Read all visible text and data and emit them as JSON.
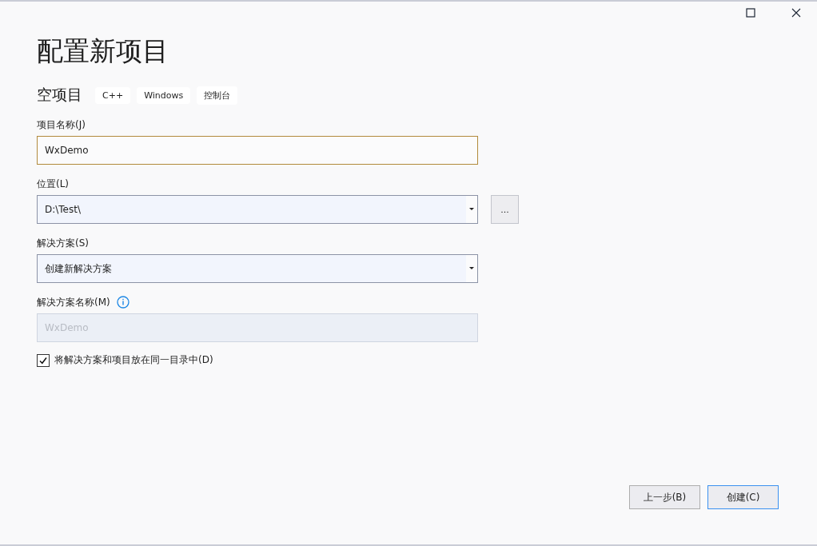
{
  "window": {
    "title": "配置新项目"
  },
  "template": {
    "name": "空项目",
    "tags": [
      "C++",
      "Windows",
      "控制台"
    ]
  },
  "fields": [
    {
      "kind": "text",
      "label": "项目名称(J)",
      "value": "WxDemo",
      "focused": true,
      "disabled": false
    },
    {
      "kind": "combo",
      "label": "位置(L)",
      "value": "D:\\Test\\",
      "focused": false,
      "disabled": false,
      "browse_button": "..."
    },
    {
      "kind": "combo",
      "label": "解决方案(S)",
      "value": "创建新解决方案",
      "focused": false,
      "disabled": false
    },
    {
      "kind": "text",
      "label": "解决方案名称(M)",
      "value": "WxDemo",
      "focused": false,
      "disabled": true,
      "info": true
    }
  ],
  "checkbox": {
    "label": "将解决方案和项目放在同一目录中(D)",
    "checked": true
  },
  "buttons": [
    {
      "label": "上一步(B)",
      "default": false
    },
    {
      "label": "创建(C)",
      "default": true
    }
  ]
}
